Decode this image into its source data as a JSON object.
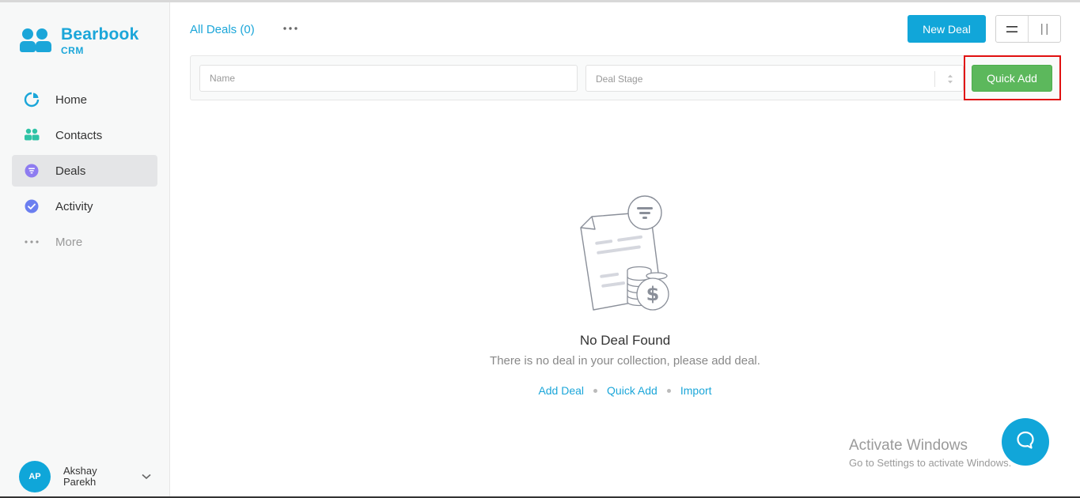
{
  "brand": {
    "name": "Bearbook",
    "sub": "CRM",
    "color": "#1ba6d9"
  },
  "sidebar": {
    "items": [
      {
        "label": "Home",
        "icon": "pie-chart-icon"
      },
      {
        "label": "Contacts",
        "icon": "contacts-icon"
      },
      {
        "label": "Deals",
        "icon": "deals-funnel-icon",
        "active": true
      },
      {
        "label": "Activity",
        "icon": "check-circle-icon"
      },
      {
        "label": "More",
        "icon": "more-dots-icon"
      }
    ]
  },
  "user": {
    "initials": "AP",
    "name": "Akshay Parekh"
  },
  "header": {
    "title": "All Deals (0)",
    "new_deal_label": "New Deal"
  },
  "filters": {
    "name_placeholder": "Name",
    "stage_placeholder": "Deal Stage",
    "quick_add_label": "Quick Add"
  },
  "empty_state": {
    "title": "No Deal Found",
    "subtitle": "There is no deal in your collection, please add deal.",
    "links": [
      "Add Deal",
      "Quick Add",
      "Import"
    ]
  },
  "watermark": {
    "title": "Activate Windows",
    "subtitle": "Go to Settings to activate Windows."
  },
  "colors": {
    "accent": "#11a6d9",
    "quick_add": "#5cb85c",
    "highlight": "#e01010",
    "home_icon": "#1ba6d9",
    "contacts_icon": "#2fc3a6",
    "deals_icon": "#8e7cf0",
    "activity_icon": "#6b7ff0"
  }
}
